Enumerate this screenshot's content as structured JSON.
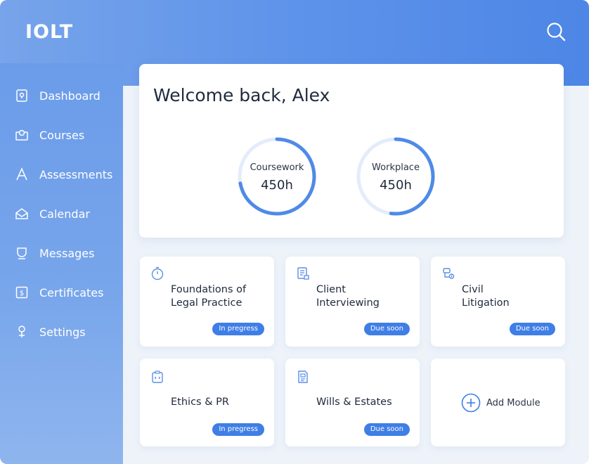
{
  "app": {
    "logo": "IOLT",
    "colors": {
      "primary": "#4d86e6",
      "sidebar": "#6b9cea",
      "badge": "#3f7ee6",
      "ring": "#4f8ae6",
      "ring_track": "#e3ecfa"
    }
  },
  "header": {
    "search_icon": "search-icon"
  },
  "sidebar": {
    "items": [
      {
        "label": "Dashboard",
        "icon": "dashboard-icon"
      },
      {
        "label": "Courses",
        "icon": "courses-icon"
      },
      {
        "label": "Assessments",
        "icon": "assessments-icon"
      },
      {
        "label": "Calendar",
        "icon": "calendar-icon"
      },
      {
        "label": "Messages",
        "icon": "messages-icon"
      },
      {
        "label": "Certificates",
        "icon": "certificates-icon"
      },
      {
        "label": "Settings",
        "icon": "settings-icon"
      }
    ]
  },
  "welcome": {
    "title": "Welcome back, Alex",
    "rings": [
      {
        "label": "Coursework",
        "value": "450h",
        "progress": 0.72
      },
      {
        "label": "Workplace",
        "value": "450h",
        "progress": 0.52
      }
    ]
  },
  "modules": [
    {
      "title_line1": "Foundations of",
      "title_line2": "Legal Practice",
      "status": "In pregress",
      "icon": "timer-icon"
    },
    {
      "title_line1": "Client",
      "title_line2": "Interviewing",
      "status": "Due soon",
      "icon": "document-icon"
    },
    {
      "title_line1": "Civil",
      "title_line2": "Litigation",
      "status": "Due soon",
      "icon": "gavel-icon"
    },
    {
      "title_line1": "Ethics & PR",
      "title_line2": "",
      "status": "In pregress",
      "icon": "clipboard-icon"
    },
    {
      "title_line1": "Wills & Estates",
      "title_line2": "",
      "status": "Due soon",
      "icon": "will-document-icon"
    }
  ],
  "add_module": {
    "label": "Add Module",
    "icon": "plus-circle-icon"
  }
}
